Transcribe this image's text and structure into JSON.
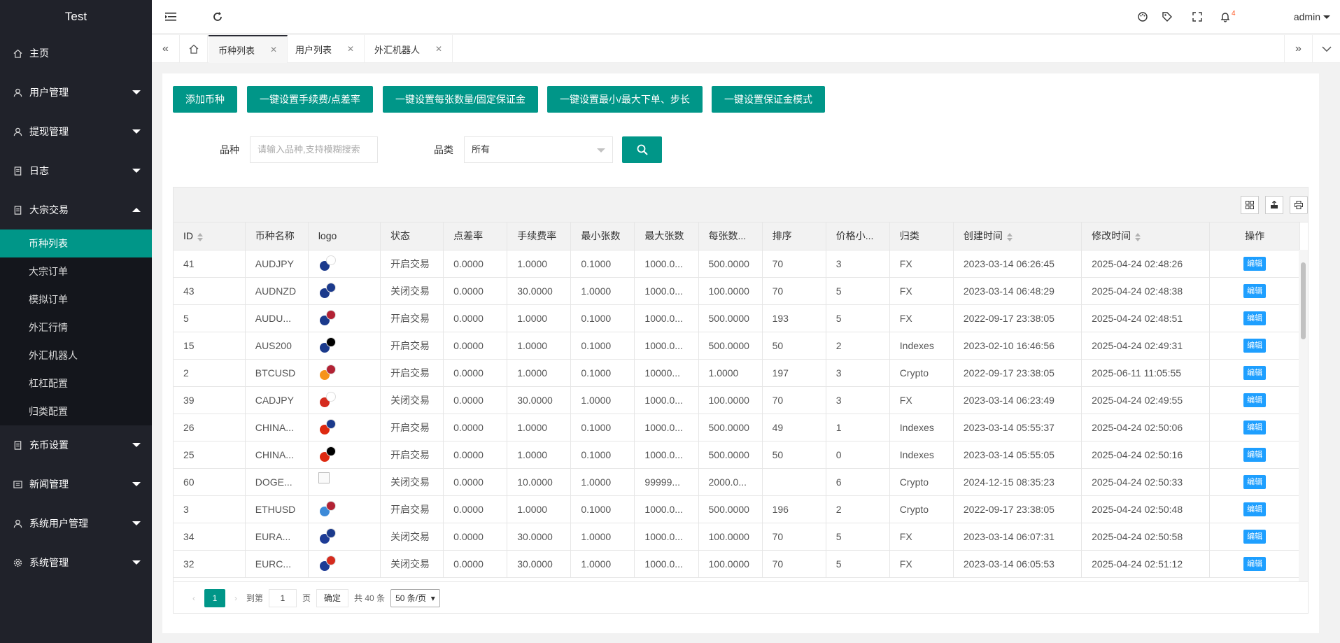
{
  "app": {
    "title": "Test"
  },
  "sidebar": {
    "items": [
      {
        "label": "主页",
        "icon": "home-icon"
      },
      {
        "label": "用户管理",
        "icon": "user-icon"
      },
      {
        "label": "提现管理",
        "icon": "user-icon"
      },
      {
        "label": "日志",
        "icon": "doc-icon"
      },
      {
        "label": "大宗交易",
        "icon": "doc-icon"
      }
    ],
    "sub_items": [
      "币种列表",
      "大宗订单",
      "模拟订单",
      "外汇行情",
      "外汇机器人",
      "杠杠配置",
      "归类配置"
    ],
    "items_after": [
      {
        "label": "充币设置",
        "icon": "doc-icon"
      },
      {
        "label": "新闻管理",
        "icon": "news-icon"
      },
      {
        "label": "系统用户管理",
        "icon": "user-icon"
      },
      {
        "label": "系统管理",
        "icon": "gear-icon"
      }
    ]
  },
  "header": {
    "user": "admin",
    "notification_count": "4"
  },
  "tabs": [
    "币种列表",
    "用户列表",
    "外汇机器人"
  ],
  "actions": {
    "add": "添加币种",
    "set_fee": "一键设置手续费/点差率",
    "set_contract": "一键设置每张数量/固定保证金",
    "set_minmax": "一键设置最小/最大下单、步长",
    "set_margin": "一键设置保证金模式"
  },
  "filter": {
    "variety_label": "品种",
    "variety_placeholder": "请输入品种,支持模糊搜索",
    "category_label": "品类",
    "category_value": "所有"
  },
  "table": {
    "headers": [
      "ID",
      "币种名称",
      "logo",
      "状态",
      "点差率",
      "手续费率",
      "最小张数",
      "最大张数",
      "每张数...",
      "排序",
      "价格小...",
      "归类",
      "创建时间",
      "修改时间",
      "操作"
    ],
    "edit_label": "编辑",
    "rows": [
      [
        "41",
        "AUDJPY",
        "开启交易",
        "0.0000",
        "1.0000",
        "0.1000",
        "1000.0...",
        "500.0000",
        "70",
        "3",
        "FX",
        "2023-03-14 06:26:45",
        "2025-04-24 02:48:26"
      ],
      [
        "43",
        "AUDNZD",
        "关闭交易",
        "0.0000",
        "30.0000",
        "1.0000",
        "1000.0...",
        "100.0000",
        "70",
        "5",
        "FX",
        "2023-03-14 06:48:29",
        "2025-04-24 02:48:38"
      ],
      [
        "5",
        "AUDU...",
        "开启交易",
        "0.0000",
        "1.0000",
        "0.1000",
        "1000.0...",
        "500.0000",
        "193",
        "5",
        "FX",
        "2022-09-17 23:38:05",
        "2025-04-24 02:48:51"
      ],
      [
        "15",
        "AUS200",
        "开启交易",
        "0.0000",
        "1.0000",
        "0.1000",
        "1000.0...",
        "500.0000",
        "50",
        "2",
        "Indexes",
        "2023-02-10 16:46:56",
        "2025-04-24 02:49:31"
      ],
      [
        "2",
        "BTCUSD",
        "开启交易",
        "0.0000",
        "1.0000",
        "0.1000",
        "10000...",
        "1.0000",
        "197",
        "3",
        "Crypto",
        "2022-09-17 23:38:05",
        "2025-06-11 11:05:55"
      ],
      [
        "39",
        "CADJPY",
        "关闭交易",
        "0.0000",
        "30.0000",
        "1.0000",
        "1000.0...",
        "100.0000",
        "70",
        "3",
        "FX",
        "2023-03-14 06:23:49",
        "2025-04-24 02:49:55"
      ],
      [
        "26",
        "CHINA...",
        "开启交易",
        "0.0000",
        "1.0000",
        "0.1000",
        "1000.0...",
        "500.0000",
        "49",
        "1",
        "Indexes",
        "2023-03-14 05:55:37",
        "2025-04-24 02:50:06"
      ],
      [
        "25",
        "CHINA...",
        "开启交易",
        "0.0000",
        "1.0000",
        "0.1000",
        "1000.0...",
        "500.0000",
        "50",
        "0",
        "Indexes",
        "2023-03-14 05:55:05",
        "2025-04-24 02:50:16"
      ],
      [
        "60",
        "DOGE...",
        "关闭交易",
        "0.0000",
        "10.0000",
        "1.0000",
        "99999...",
        "2000.0...",
        "",
        "6",
        "Crypto",
        "2024-12-15 08:35:23",
        "2025-04-24 02:50:33"
      ],
      [
        "3",
        "ETHUSD",
        "开启交易",
        "0.0000",
        "1.0000",
        "0.1000",
        "1000.0...",
        "500.0000",
        "196",
        "2",
        "Crypto",
        "2022-09-17 23:38:05",
        "2025-04-24 02:50:48"
      ],
      [
        "34",
        "EURA...",
        "关闭交易",
        "0.0000",
        "30.0000",
        "1.0000",
        "1000.0...",
        "100.0000",
        "70",
        "5",
        "FX",
        "2023-03-14 06:07:31",
        "2025-04-24 02:50:58"
      ],
      [
        "32",
        "EURC...",
        "关闭交易",
        "0.0000",
        "30.0000",
        "1.0000",
        "1000.0...",
        "100.0000",
        "70",
        "5",
        "FX",
        "2023-03-14 06:05:53",
        "2025-04-24 02:51:12"
      ]
    ],
    "flags": [
      [
        "#1b3a8c",
        "#ffffff"
      ],
      [
        "#1b3a8c",
        "#1b3a8c"
      ],
      [
        "#1b3a8c",
        "#b22234"
      ],
      [
        "#1b3a8c",
        "#000000"
      ],
      [
        "#f7931a",
        "#b22234"
      ],
      [
        "#d52b1e",
        "#ffffff"
      ],
      [
        "#de2910",
        "#1b3a8c"
      ],
      [
        "#de2910",
        "#000000"
      ],
      [
        "",
        ""
      ],
      [
        "#3c8ad8",
        "#b22234"
      ],
      [
        "#1e3c96",
        "#1b3a8c"
      ],
      [
        "#1e3c96",
        "#d52b1e"
      ]
    ]
  },
  "pager": {
    "current": "1",
    "goto_label": "到第",
    "page_value": "1",
    "page_unit": "页",
    "confirm": "确定",
    "total": "共 40 条",
    "page_size": "50 条/页"
  }
}
